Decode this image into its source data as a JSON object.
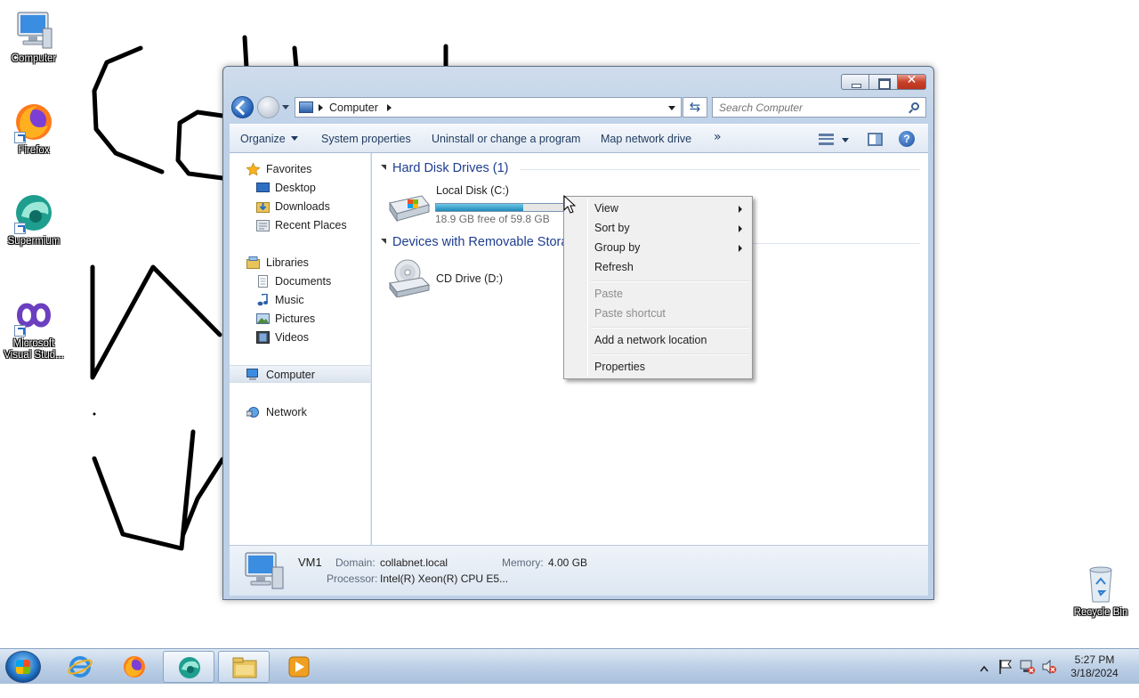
{
  "desktop": {
    "icons": [
      {
        "label": "Computer"
      },
      {
        "label": "Firefox"
      },
      {
        "label": "Supermium"
      },
      {
        "label": "Microsoft Visual Stud..."
      },
      {
        "label": "Recycle Bin"
      }
    ]
  },
  "window": {
    "address": {
      "crumb": "Computer"
    },
    "search": {
      "placeholder": "Search Computer"
    },
    "toolbar": {
      "organize": "Organize",
      "system_properties": "System properties",
      "uninstall": "Uninstall or change a program",
      "map_drive": "Map network drive",
      "more": "»"
    },
    "nav": {
      "favorites": "Favorites",
      "desktop": "Desktop",
      "downloads": "Downloads",
      "recent_places": "Recent Places",
      "libraries": "Libraries",
      "documents": "Documents",
      "music": "Music",
      "pictures": "Pictures",
      "videos": "Videos",
      "computer": "Computer",
      "network": "Network"
    },
    "content": {
      "hard_disk_header": "Hard Disk Drives (1)",
      "local_disk_name": "Local Disk (C:)",
      "local_disk_free": "18.9 GB free of 59.8 GB",
      "local_disk_used_fraction": 0.684,
      "removable_header": "Devices with Removable Storage (1)",
      "cd_drive_name": "CD Drive (D:)"
    },
    "details": {
      "name": "VM1",
      "domain_label": "Domain:",
      "domain_value": "collabnet.local",
      "memory_label": "Memory:",
      "memory_value": "4.00 GB",
      "processor_label": "Processor:",
      "processor_value": "Intel(R) Xeon(R) CPU E5..."
    }
  },
  "context_menu": {
    "view": "View",
    "sort_by": "Sort by",
    "group_by": "Group by",
    "refresh": "Refresh",
    "paste": "Paste",
    "paste_shortcut": "Paste shortcut",
    "add_network_location": "Add a network location",
    "properties": "Properties"
  },
  "taskbar": {
    "clock_time": "5:27 PM",
    "clock_date": "3/18/2024"
  }
}
